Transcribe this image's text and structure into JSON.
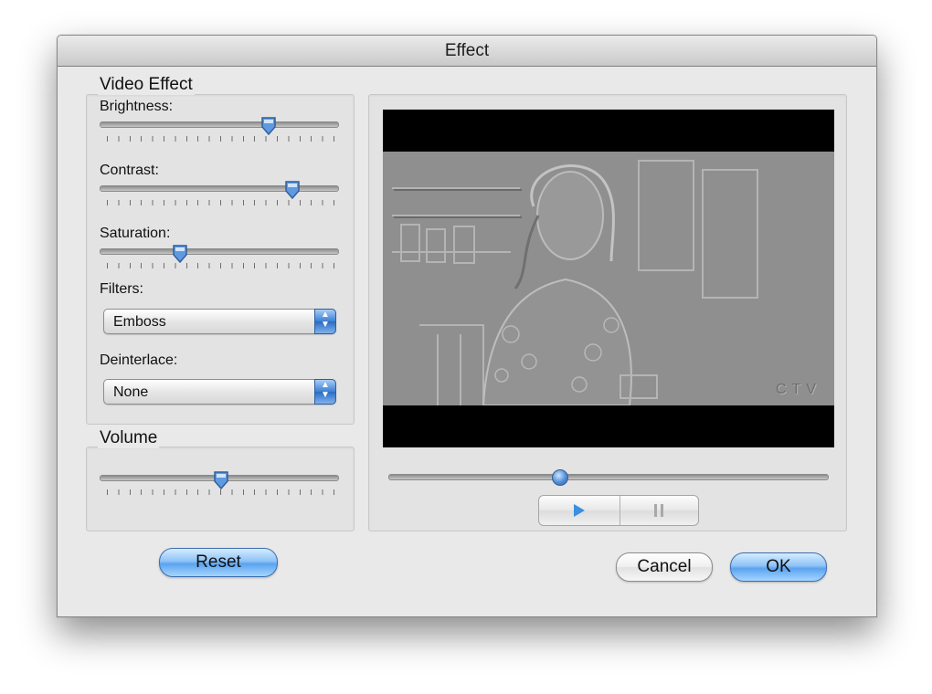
{
  "window": {
    "title": "Effect"
  },
  "video_effect": {
    "legend": "Video Effect",
    "brightness": {
      "label": "Brightness:",
      "level": 0.71
    },
    "contrast": {
      "label": "Contrast:",
      "level": 0.81
    },
    "saturation": {
      "label": "Saturation:",
      "level": 0.34
    },
    "filters": {
      "label": "Filters:",
      "value": "Emboss"
    },
    "deinterlace": {
      "label": "Deinterlace:",
      "value": "None"
    }
  },
  "volume": {
    "legend": "Volume",
    "level": 0.51
  },
  "preview": {
    "watermark": "CTV",
    "position": 0.39
  },
  "buttons": {
    "reset": "Reset",
    "cancel": "Cancel",
    "ok": "OK"
  },
  "icons": {
    "play": "play-icon",
    "pause": "pause-icon",
    "popup_arrows": "updown-arrows-icon"
  },
  "colors": {
    "accent": "#4f8fd8",
    "window_bg": "#e9e9e9"
  }
}
